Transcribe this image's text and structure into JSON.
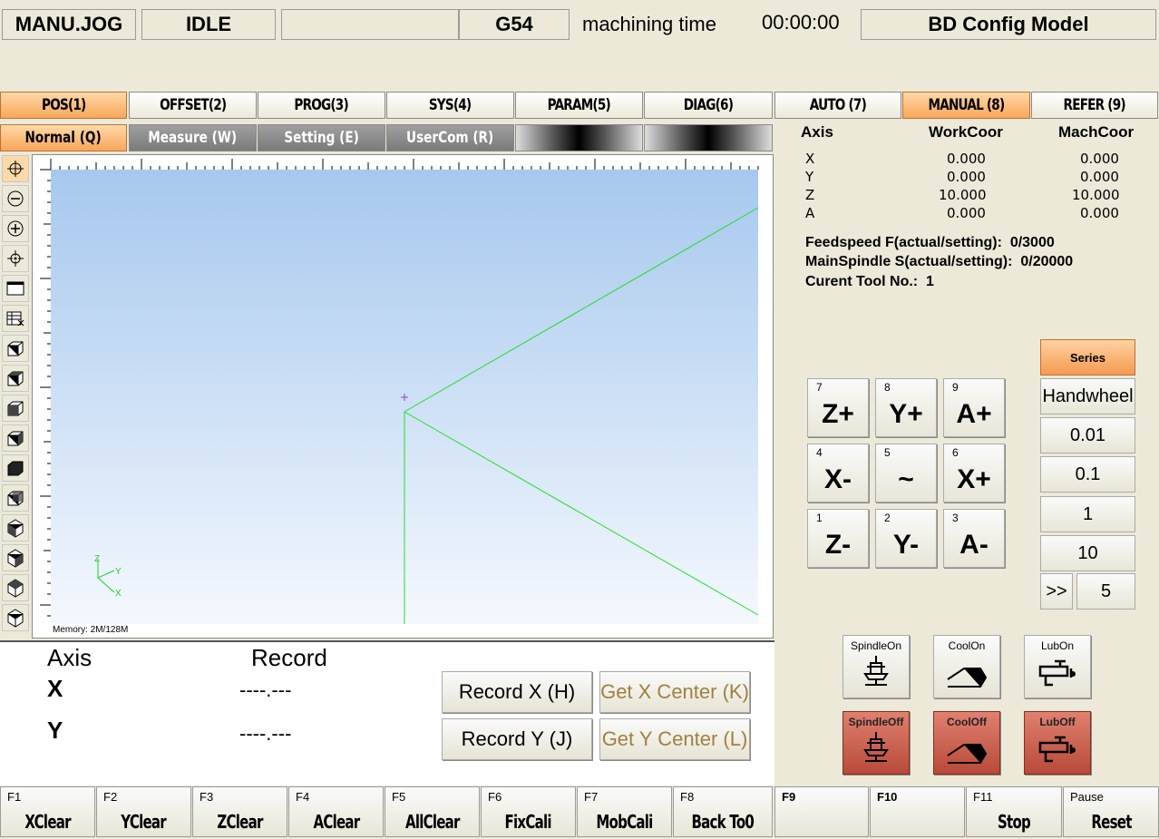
{
  "status": {
    "mode": "MANU.JOG",
    "state": "IDLE",
    "blank": "",
    "coord_sys": "G54",
    "time_label": "machining time",
    "time_value": "00:00:00",
    "config": "BD Config Model"
  },
  "main_tabs": [
    "POS(1)",
    "OFFSET(2)",
    "PROG(3)",
    "SYS(4)",
    "PARAM(5)",
    "DIAG(6)"
  ],
  "mode_tabs": [
    "AUTO (7)",
    "MANUAL (8)",
    "REFER (9)"
  ],
  "sub_tabs": [
    "Normal (Q)",
    "Measure (W)",
    "Setting (E)",
    "UserCom (R)"
  ],
  "viewer": {
    "memory": "Memory: 2M/128M",
    "axis_z": "Z",
    "axis_y": "Y",
    "axis_x": "X"
  },
  "coords": {
    "headers": [
      "Axis",
      "WorkCoor",
      "MachCoor"
    ],
    "rows": [
      [
        "X",
        "0.000",
        "0.000"
      ],
      [
        "Y",
        "0.000",
        "0.000"
      ],
      [
        "Z",
        "10.000",
        "10.000"
      ],
      [
        "A",
        "0.000",
        "0.000"
      ]
    ]
  },
  "info": {
    "feed_label": "Feedspeed F(actual/setting):",
    "feed_value": "0/3000",
    "spindle_label": "MainSpindle S(actual/setting):",
    "spindle_value": "0/20000",
    "tool_label": "Curent Tool No.:",
    "tool_value": "1"
  },
  "jog": [
    {
      "num": "7",
      "label": "Z+"
    },
    {
      "num": "8",
      "label": "Y+"
    },
    {
      "num": "9",
      "label": "A+"
    },
    {
      "num": "4",
      "label": "X-"
    },
    {
      "num": "5",
      "label": "~"
    },
    {
      "num": "6",
      "label": "X+"
    },
    {
      "num": "1",
      "label": "Z-"
    },
    {
      "num": "2",
      "label": "Y-"
    },
    {
      "num": "3",
      "label": "A-"
    }
  ],
  "step": {
    "series": "Series",
    "handwheel": "Handwheel",
    "s1": "0.01",
    "s2": "0.1",
    "s3": "1",
    "s4": "10",
    "more": ">>",
    "custom": "5"
  },
  "io": {
    "spindle_on": "SpindleOn",
    "cool_on": "CoolOn",
    "lub_on": "LubOn",
    "spindle_off": "SpindleOff",
    "cool_off": "CoolOff",
    "lub_off": "LubOff"
  },
  "record": {
    "axis_header": "Axis",
    "record_header": "Record",
    "x_label": "X",
    "y_label": "Y",
    "x_value": "----.---",
    "y_value": "----.---",
    "rec_x": "Record X (H)",
    "rec_y": "Record Y (J)",
    "center_x": "Get X Center (K)",
    "center_y": "Get Y Center (L)"
  },
  "fkeys": [
    {
      "fn": "F1",
      "label": "XClear"
    },
    {
      "fn": "F2",
      "label": "YClear"
    },
    {
      "fn": "F3",
      "label": "ZClear"
    },
    {
      "fn": "F4",
      "label": "AClear"
    },
    {
      "fn": "F5",
      "label": "AllClear"
    },
    {
      "fn": "F6",
      "label": "FixCali"
    },
    {
      "fn": "F7",
      "label": "MobCali"
    },
    {
      "fn": "F8",
      "label": "Back To0"
    },
    {
      "fn": "F9",
      "label": ""
    },
    {
      "fn": "F10",
      "label": ""
    },
    {
      "fn": "F11",
      "label": "Stop"
    },
    {
      "fn": "Pause",
      "label": "Reset"
    }
  ]
}
